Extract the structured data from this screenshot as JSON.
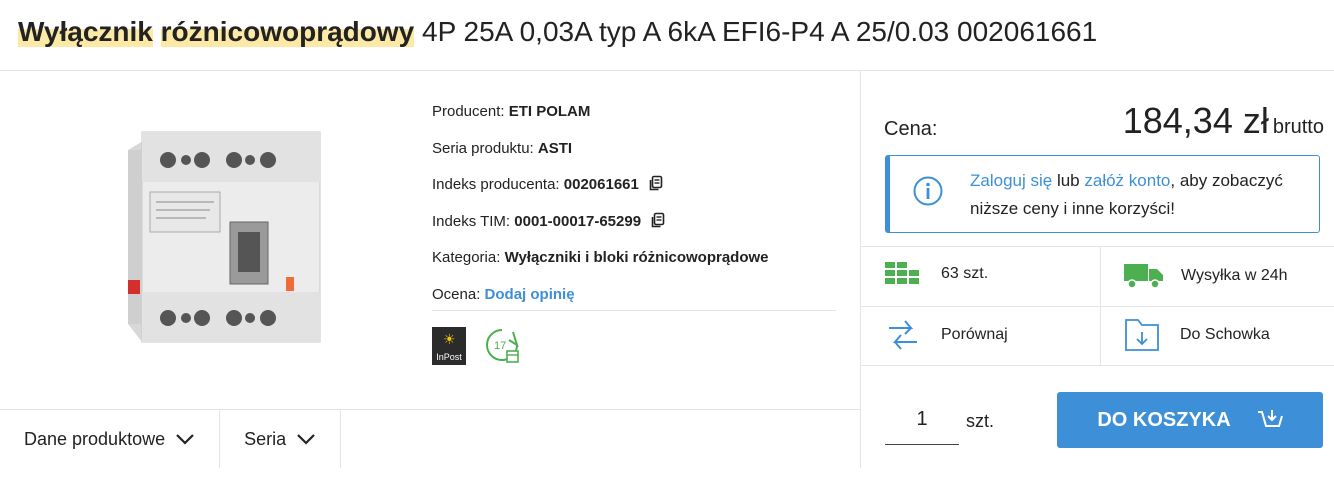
{
  "title": {
    "highlight_1": "Wyłącznik",
    "highlight_2": "różnicowoprądowy",
    "rest": "4P 25A 0,03A typ A 6kA EFI6-P4 A 25/0.03 002061661"
  },
  "specs": {
    "producer_label": "Producent:",
    "producer_value": "ETI POLAM",
    "series_label": "Seria produktu:",
    "series_value": "ASTI",
    "producer_index_label": "Indeks producenta:",
    "producer_index_value": "002061661",
    "tim_index_label": "Indeks TIM:",
    "tim_index_value": "0001-00017-65299",
    "category_label": "Kategoria:",
    "category_value": "Wyłączniki i bloki różnicowoprądowe",
    "rating_label": "Ocena:",
    "rating_link": "Dodaj opinię"
  },
  "badges": {
    "inpost_label": "InPost",
    "days_label": "17"
  },
  "tabs": [
    {
      "label": "Dane produktowe"
    },
    {
      "label": "Seria"
    }
  ],
  "price": {
    "label": "Cena:",
    "amount": "184,34 zł",
    "suffix": "brutto"
  },
  "login": {
    "link_login": "Zaloguj się",
    "or": "lub",
    "link_register": "załóż konto",
    "rest": ", aby zobaczyć niższe ceny i inne korzyści!"
  },
  "features": {
    "stock": "63 szt.",
    "shipping": "Wysyłka w 24h",
    "compare": "Porównaj",
    "clipboard": "Do Schowka"
  },
  "cart": {
    "quantity": "1",
    "unit": "szt.",
    "button_label": "DO KOSZYKA"
  },
  "colors": {
    "accent": "#3d8fd8",
    "highlight": "#fde9a6",
    "stock_green": "#4caf50"
  }
}
